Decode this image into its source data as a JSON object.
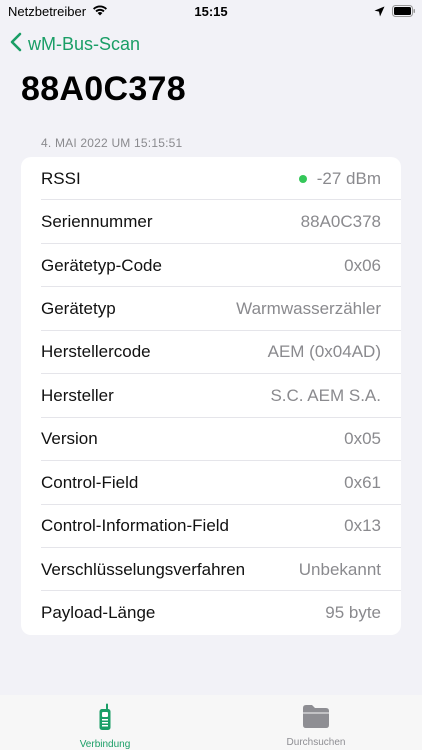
{
  "status_bar": {
    "carrier": "Netzbetreiber",
    "time": "15:15"
  },
  "nav": {
    "back_label": "wM-Bus-Scan"
  },
  "page": {
    "title": "88A0C378",
    "section_header": "4. MAI 2022 UM 15:15:51"
  },
  "details": [
    {
      "key": "RSSI",
      "value": "-27 dBm"
    },
    {
      "key": "Seriennummer",
      "value": "88A0C378"
    },
    {
      "key": "Gerätetyp-Code",
      "value": "0x06"
    },
    {
      "key": "Gerätetyp",
      "value": "Warmwasserzähler"
    },
    {
      "key": "Herstellercode",
      "value": "AEM (0x04AD)"
    },
    {
      "key": "Hersteller",
      "value": "S.C. AEM S.A."
    },
    {
      "key": "Version",
      "value": "0x05"
    },
    {
      "key": "Control-Field",
      "value": "0x61"
    },
    {
      "key": "Control-Information-Field",
      "value": "0x13"
    },
    {
      "key": "Verschlüsselungsverfahren",
      "value": "Unbekannt"
    },
    {
      "key": "Payload-Länge",
      "value": "95 byte"
    }
  ],
  "tabs": [
    {
      "label": "Verbindung",
      "icon": "radio-device-icon",
      "selected": true
    },
    {
      "label": "Durchsuchen",
      "icon": "folder-icon",
      "selected": false
    }
  ],
  "colors": {
    "accent": "#1a9e66",
    "signal_dot": "#34c759",
    "background": "#f2f2f7",
    "secondary_text": "#8a8a8e"
  }
}
